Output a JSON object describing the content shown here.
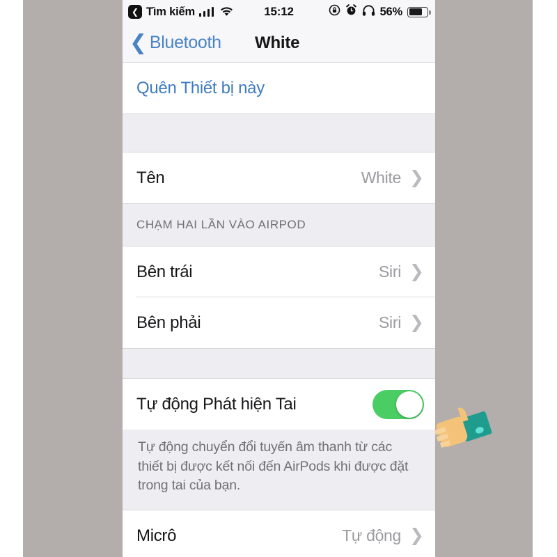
{
  "status_bar": {
    "back_badge_icon": "back-chevron-badge-icon",
    "carrier_label": "Tìm kiếm",
    "signal_icon": "cellular-signal-icon",
    "wifi_icon": "wifi-icon",
    "time": "15:12",
    "rotation_lock_icon": "rotation-lock-icon",
    "alarm_icon": "alarm-clock-icon",
    "headphones_icon": "headphones-icon",
    "battery_percent": "56%",
    "battery_icon": "battery-icon",
    "battery_level": 56
  },
  "nav_bar": {
    "back_icon": "chevron-left-icon",
    "back_label": "Bluetooth",
    "title": "White"
  },
  "sections": {
    "forget": {
      "action_label": "Quên Thiết bị này"
    },
    "name_row": {
      "label": "Tên",
      "value": "White",
      "chevron_icon": "chevron-right-icon"
    },
    "double_tap": {
      "header": "CHẠM HAI LẦN VÀO AIRPOD",
      "rows": [
        {
          "label": "Bên trái",
          "value": "Siri",
          "chevron_icon": "chevron-right-icon"
        },
        {
          "label": "Bên phải",
          "value": "Siri",
          "chevron_icon": "chevron-right-icon"
        }
      ]
    },
    "ear_detection": {
      "label": "Tự động Phát hiện Tai",
      "toggle_state": "on",
      "toggle_color": "#4ACD63",
      "footer": "Tự động chuyển đổi tuyến âm thanh từ các thiết bị được kết nối đến AirPods khi được đặt trong tai của bạn."
    },
    "microphone_row": {
      "label": "Micrô",
      "value": "Tự động",
      "chevron_icon": "chevron-right-icon"
    }
  },
  "annotation": {
    "hand_icon": "pointing-hand-icon",
    "hand_skin_color": "#F5C27A",
    "hand_sleeve_color": "#1F9C8E"
  },
  "colors": {
    "backdrop": "#b3adac",
    "link_blue": "#3f7cc0",
    "group_background": "#eeeef2"
  }
}
